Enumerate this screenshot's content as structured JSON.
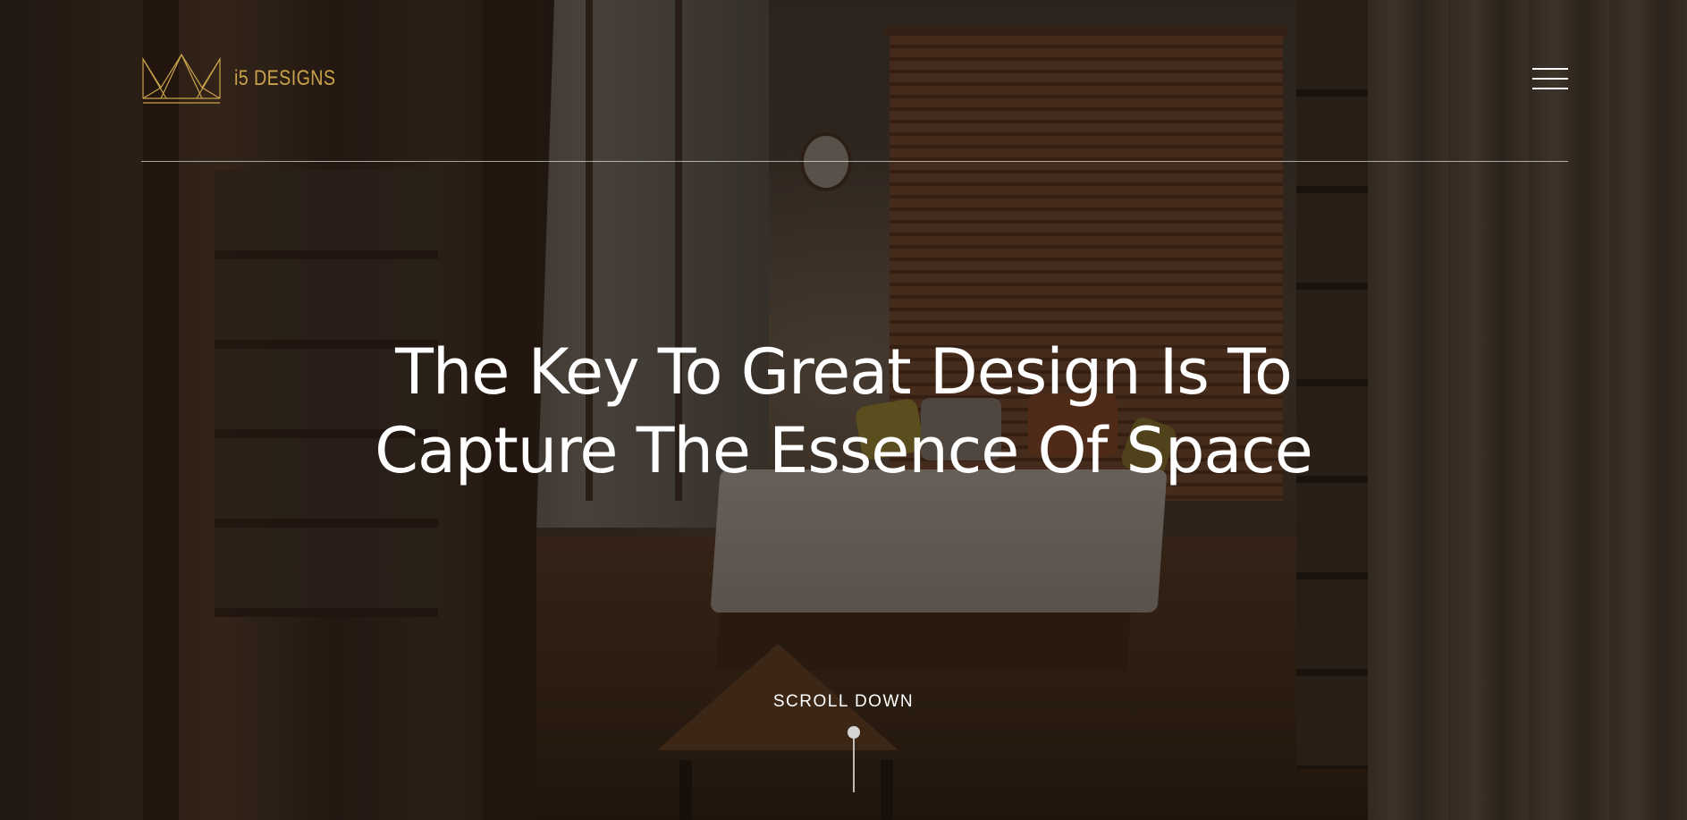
{
  "header": {
    "logo_text": "i5 DESIGNS",
    "logo_icon": "crown-icon",
    "menu_icon": "hamburger-menu-icon"
  },
  "hero": {
    "headline_line1": "The Key To Great Design Is To",
    "headline_line2": "Capture The Essence Of Space",
    "scroll_label": "SCROLL DOWN"
  },
  "colors": {
    "brand_gold": "#c9a24b",
    "text": "#ffffff"
  }
}
